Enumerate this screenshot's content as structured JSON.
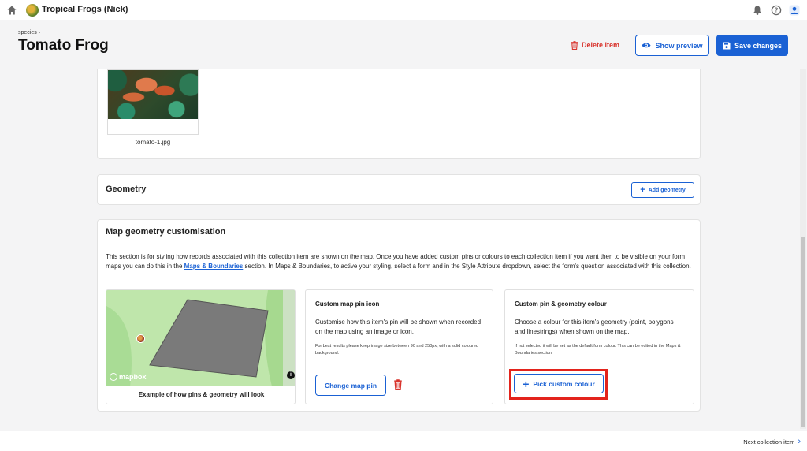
{
  "topbar": {
    "project_name": "Tropical Frogs (Nick)"
  },
  "header": {
    "breadcrumb": "species",
    "title": "Tomato Frog",
    "delete_label": "Delete item",
    "preview_label": "Show preview",
    "save_label": "Save changes"
  },
  "images": {
    "filename": "tomato-1.jpg"
  },
  "geometry": {
    "title": "Geometry",
    "add_label": "Add geometry"
  },
  "map_customisation": {
    "title": "Map geometry customisation",
    "description_1": "This section is for styling how records associated with this collection item are shown on the map. Once you have added custom pins or colours to each collection item if you want then to be visible on your form maps you can do this in the ",
    "description_link": "Maps & Boundaries",
    "description_2": " section. In Maps & Boundaries, to active your styling, select a form and in the Style Attribute dropdown, select the form's question associated with this collection.",
    "map_caption": "Example of how pins & geometry will look",
    "map_logo": "mapbox",
    "pin": {
      "title": "Custom map pin icon",
      "body": "Customise how this item's pin will be shown when recorded on the map using an image or icon.",
      "note": "For best results please keep image size between 90 and 250px, with a solid coloured background.",
      "button": "Change map pin"
    },
    "colour": {
      "title": "Custom pin & geometry colour",
      "body": "Choose a colour for this item's geometry (point, polygons and linestrings) when shown on the map.",
      "note": "If not selected it will be set as the default form colour. This can be edited in the Maps & Boundaries section.",
      "button": "Pick custom colour"
    }
  },
  "footer": {
    "next_label": "Next collection item"
  },
  "colors": {
    "primary": "#1a61d4",
    "danger": "#d8322b",
    "highlight": "#e3231c"
  }
}
